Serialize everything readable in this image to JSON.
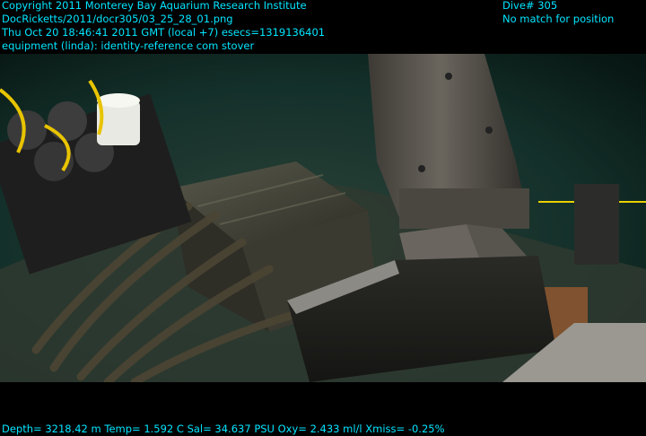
{
  "overlay": {
    "line1": "Copyright 2011 Monterey Bay Aquarium Research Institute",
    "line2": "DocRicketts/2011/docr305/03_25_28_01.png",
    "line3": "Thu Oct 20 18:46:41 2011 GMT (local +7)  esecs=1319136401",
    "line4": "equipment (linda): identity-reference com stover",
    "dive": "Dive# 305",
    "position": "No match for position",
    "sensors": "Depth= 3218.42 m  Temp= 1.592 C  Sal= 34.637 PSU  Oxy= 2.433 ml/l  Xmiss= -0.25%"
  },
  "colors": {
    "overlay_text": "#00e5ff",
    "water": "#0e2a22",
    "sediment": "#3a3a30",
    "arm": "#5a5650"
  }
}
